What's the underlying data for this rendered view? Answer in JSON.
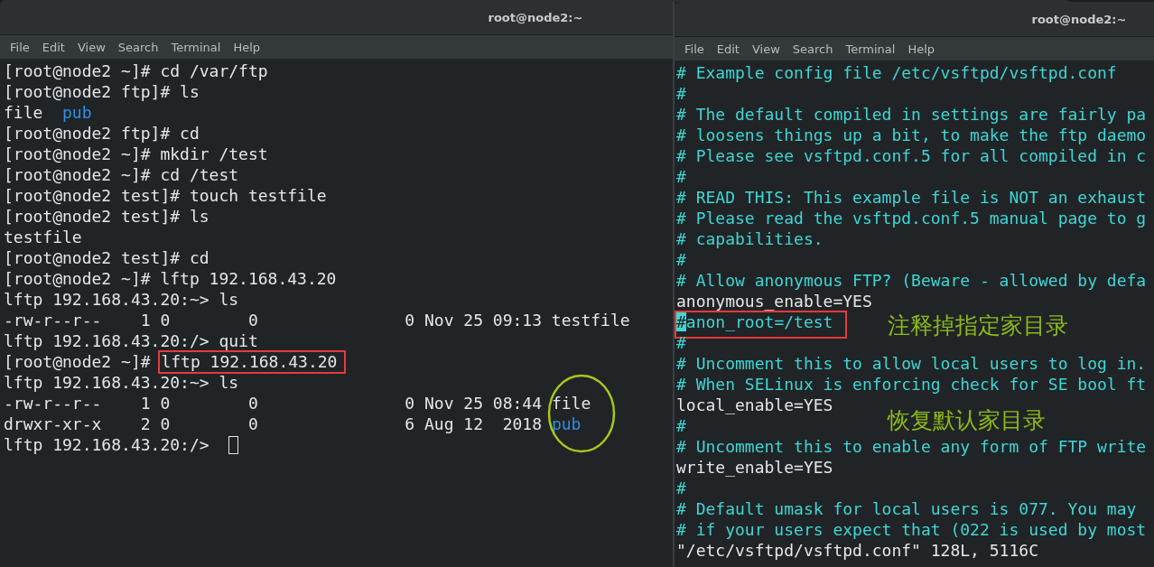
{
  "windows": [
    {
      "title": "root@node2:~",
      "menu": [
        "File",
        "Edit",
        "View",
        "Search",
        "Terminal",
        "Help"
      ],
      "cursor_at_end": true,
      "lines": [
        [
          {
            "text": "[root@node2 ~]# cd /var/ftp",
            "kind": "plain"
          }
        ],
        [
          {
            "text": "[root@node2 ftp]# ls",
            "kind": "plain"
          }
        ],
        [
          {
            "text": "file  ",
            "kind": "plain"
          },
          {
            "text": "pub",
            "kind": "dir"
          }
        ],
        [
          {
            "text": "[root@node2 ftp]# cd",
            "kind": "plain"
          }
        ],
        [
          {
            "text": "[root@node2 ~]# mkdir /test",
            "kind": "plain"
          }
        ],
        [
          {
            "text": "[root@node2 ~]# cd /test",
            "kind": "plain"
          }
        ],
        [
          {
            "text": "[root@node2 test]# touch testfile",
            "kind": "plain"
          }
        ],
        [
          {
            "text": "[root@node2 test]# ls",
            "kind": "plain"
          }
        ],
        [
          {
            "text": "testfile",
            "kind": "plain"
          }
        ],
        [
          {
            "text": "[root@node2 test]# cd",
            "kind": "plain"
          }
        ],
        [
          {
            "text": "[root@node2 ~]# lftp 192.168.43.20",
            "kind": "plain"
          }
        ],
        [
          {
            "text": "lftp 192.168.43.20:~> ls",
            "kind": "plain"
          }
        ],
        [
          {
            "text": "-rw-r--r--    1 0        0               0 Nov 25 09:13 testfile",
            "kind": "plain"
          }
        ],
        [
          {
            "text": "lftp 192.168.43.20:/> quit",
            "kind": "plain"
          }
        ],
        [
          {
            "text": "[root@node2 ~]# ",
            "kind": "plain"
          },
          {
            "kind": "box",
            "parts": [
              {
                "text": "lftp 192.168.43.20",
                "kind": "plain"
              }
            ]
          }
        ],
        [
          {
            "text": "lftp 192.168.43.20:~> ls",
            "kind": "plain"
          }
        ],
        [
          {
            "text": "-rw-r--r--    1 0        0               0 Nov 25 08:44 ",
            "kind": "plain"
          },
          {
            "text": "file",
            "kind": "plain"
          }
        ],
        [
          {
            "text": "drwxr-xr-x    2 0        0               6 Aug 12  2018 ",
            "kind": "plain"
          },
          {
            "text": "pub",
            "kind": "dir"
          }
        ],
        [
          {
            "text": "lftp 192.168.43.20:/> ",
            "kind": "plain"
          }
        ]
      ],
      "notes": [
        {
          "kind": "ellipse"
        }
      ]
    },
    {
      "title": "root@node2:~",
      "menu": [
        "File",
        "Edit",
        "View",
        "Search",
        "Terminal",
        "Help"
      ],
      "cursor_at_end": false,
      "lines": [
        [
          {
            "text": "# Example config file /etc/vsftpd/vsftpd.conf",
            "kind": "comment"
          }
        ],
        [
          {
            "text": "#",
            "kind": "comment"
          }
        ],
        [
          {
            "text": "# The default compiled in settings are fairly pa",
            "kind": "comment"
          }
        ],
        [
          {
            "text": "# loosens things up a bit, to make the ftp daemo",
            "kind": "comment"
          }
        ],
        [
          {
            "text": "# Please see vsftpd.conf.5 for all compiled in c",
            "kind": "comment"
          }
        ],
        [
          {
            "text": "#",
            "kind": "comment"
          }
        ],
        [
          {
            "text": "# READ THIS: This example file is NOT an exhaust",
            "kind": "comment"
          }
        ],
        [
          {
            "text": "# Please read the vsftpd.conf.5 manual page to g",
            "kind": "comment"
          }
        ],
        [
          {
            "text": "# capabilities.",
            "kind": "comment"
          }
        ],
        [
          {
            "text": "#",
            "kind": "comment"
          }
        ],
        [
          {
            "text": "# Allow anonymous FTP? (Beware - allowed by defa",
            "kind": "comment"
          }
        ],
        [
          {
            "text": "anonymous_enable=YES",
            "kind": "plain"
          }
        ],
        [
          {
            "kind": "box",
            "parts": [
              {
                "text": "#",
                "kind": "cursor"
              },
              {
                "text": "anon_root=/test",
                "kind": "comment"
              }
            ]
          }
        ],
        [
          {
            "text": "#",
            "kind": "comment"
          }
        ],
        [
          {
            "text": "# Uncomment this to allow local users to log in.",
            "kind": "comment"
          }
        ],
        [
          {
            "text": "# When SELinux is enforcing check for SE bool ft",
            "kind": "comment"
          }
        ],
        [
          {
            "text": "local_enable=YES",
            "kind": "plain"
          }
        ],
        [
          {
            "text": "#",
            "kind": "comment"
          }
        ],
        [
          {
            "text": "# Uncomment this to enable any form of FTP write",
            "kind": "comment"
          }
        ],
        [
          {
            "text": "write_enable=YES",
            "kind": "plain"
          }
        ],
        [
          {
            "text": "#",
            "kind": "comment"
          }
        ],
        [
          {
            "text": "# Default umask for local users is 077. You may ",
            "kind": "comment"
          }
        ],
        [
          {
            "text": "# if your users expect that (022 is used by most",
            "kind": "comment"
          }
        ],
        [
          {
            "text": "\"/etc/vsftpd/vsftpd.conf\" 128L, 5116C",
            "kind": "plain"
          }
        ]
      ],
      "notes": [
        {
          "kind": "text",
          "text": "注释掉指定家目录"
        },
        {
          "kind": "text",
          "text": "恢复默认家目录"
        }
      ]
    }
  ]
}
